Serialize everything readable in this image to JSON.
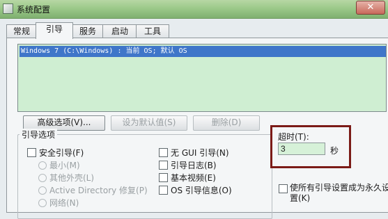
{
  "window": {
    "title": "系统配置",
    "close_symbol": "✕"
  },
  "tabs": [
    {
      "label": "常规"
    },
    {
      "label": "引导"
    },
    {
      "label": "服务"
    },
    {
      "label": "启动"
    },
    {
      "label": "工具"
    }
  ],
  "active_tab": "引导",
  "boot_entries": [
    {
      "text": "Windows 7 (C:\\Windows) : 当前 OS; 默认 OS"
    }
  ],
  "buttons": {
    "advanced": "高级选项(V)...",
    "set_default": "设为默认值(S)",
    "delete": "删除(D)"
  },
  "boot_options": {
    "title": "引导选项",
    "safe_boot": "安全引导(F)",
    "minimal": "最小(M)",
    "alternate_shell": "其他外壳(L)",
    "ad_repair": "Active Directory 修复(P)",
    "network": "网络(N)",
    "no_gui": "无 GUI 引导(N)",
    "boot_log": "引导日志(B)",
    "base_video": "基本视频(E)",
    "os_boot_info": "OS 引导信息(O)"
  },
  "timeout": {
    "label": "超时(T):",
    "value": "3",
    "unit": "秒"
  },
  "permanent": {
    "label": "使所有引导设置成为永久设置(K)"
  }
}
